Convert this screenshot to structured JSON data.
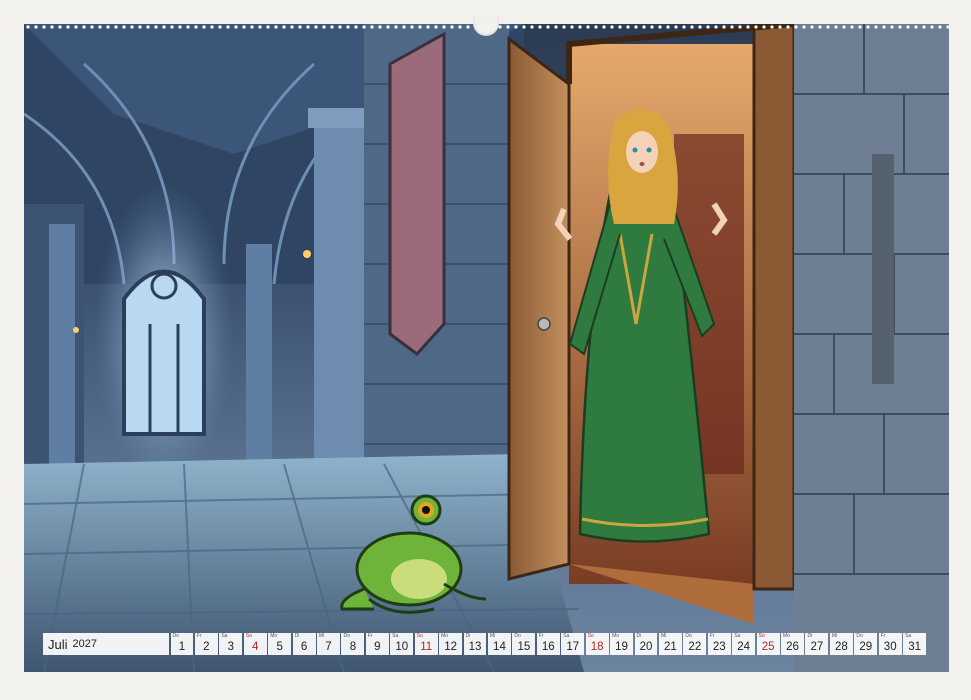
{
  "calendar": {
    "month": "Juli",
    "year": "2027",
    "days": [
      {
        "d": "1",
        "wd": "Do",
        "weekend": false
      },
      {
        "d": "2",
        "wd": "Fr",
        "weekend": false
      },
      {
        "d": "3",
        "wd": "Sa",
        "weekend": false
      },
      {
        "d": "4",
        "wd": "So",
        "weekend": true
      },
      {
        "d": "5",
        "wd": "Mo",
        "weekend": false
      },
      {
        "d": "6",
        "wd": "Di",
        "weekend": false
      },
      {
        "d": "7",
        "wd": "Mi",
        "weekend": false
      },
      {
        "d": "8",
        "wd": "Do",
        "weekend": false
      },
      {
        "d": "9",
        "wd": "Fr",
        "weekend": false
      },
      {
        "d": "10",
        "wd": "Sa",
        "weekend": false
      },
      {
        "d": "11",
        "wd": "So",
        "weekend": true
      },
      {
        "d": "12",
        "wd": "Mo",
        "weekend": false
      },
      {
        "d": "13",
        "wd": "Di",
        "weekend": false
      },
      {
        "d": "14",
        "wd": "Mi",
        "weekend": false
      },
      {
        "d": "15",
        "wd": "Do",
        "weekend": false
      },
      {
        "d": "16",
        "wd": "Fr",
        "weekend": false
      },
      {
        "d": "17",
        "wd": "Sa",
        "weekend": false
      },
      {
        "d": "18",
        "wd": "So",
        "weekend": true
      },
      {
        "d": "19",
        "wd": "Mo",
        "weekend": false
      },
      {
        "d": "20",
        "wd": "Di",
        "weekend": false
      },
      {
        "d": "21",
        "wd": "Mi",
        "weekend": false
      },
      {
        "d": "22",
        "wd": "Do",
        "weekend": false
      },
      {
        "d": "23",
        "wd": "Fr",
        "weekend": false
      },
      {
        "d": "24",
        "wd": "Sa",
        "weekend": false
      },
      {
        "d": "25",
        "wd": "So",
        "weekend": true
      },
      {
        "d": "26",
        "wd": "Mo",
        "weekend": false
      },
      {
        "d": "27",
        "wd": "Di",
        "weekend": false
      },
      {
        "d": "28",
        "wd": "Mi",
        "weekend": false
      },
      {
        "d": "29",
        "wd": "Do",
        "weekend": false
      },
      {
        "d": "30",
        "wd": "Fr",
        "weekend": false
      },
      {
        "d": "31",
        "wd": "Sa",
        "weekend": false
      }
    ]
  },
  "colors": {
    "weekend": "#b4291e",
    "dress": "#2f7a3e",
    "frog": "#6fb43a",
    "stone": "#4f6886"
  }
}
